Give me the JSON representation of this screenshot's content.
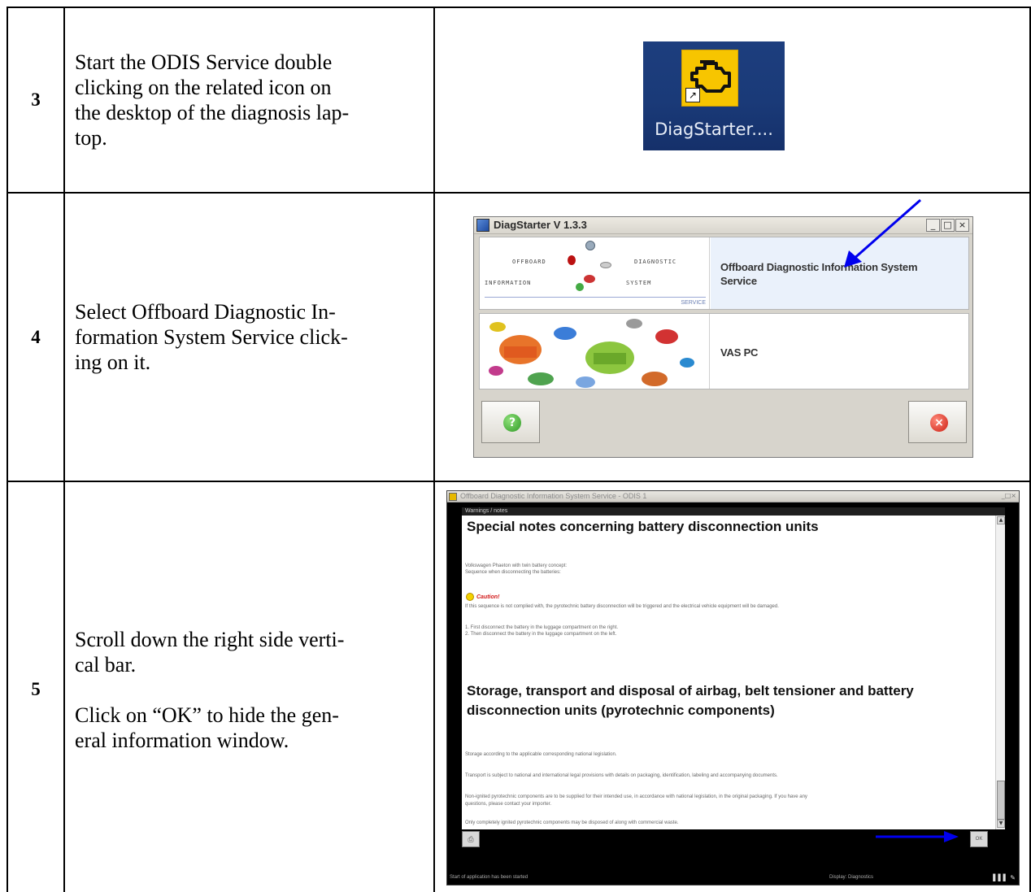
{
  "steps": [
    {
      "number": "3",
      "lines": [
        "Start the ODIS Service double",
        "clicking on the related icon on",
        "the desktop of the diagnosis lap-",
        "top."
      ]
    },
    {
      "number": "4",
      "lines": [
        "Select Offboard Diagnostic In-",
        "formation System Service click-",
        "ing on it."
      ]
    },
    {
      "number": "5",
      "lines": [
        "Scroll down the right side verti-",
        "cal bar."
      ],
      "lines2": [
        "Click on “OK” to hide the gen-",
        "eral information window."
      ]
    }
  ],
  "desktop_icon": {
    "label": "DiagStarter...."
  },
  "diagstarter": {
    "title": "DiagStarter V 1.3.3",
    "window_buttons": [
      "_",
      "□",
      "×"
    ],
    "logo_words": [
      "OFFBOARD",
      "DIAGNOSTIC",
      "INFORMATION",
      "SYSTEM",
      "SERVICE"
    ],
    "option1_lines": [
      "Offboard Diagnostic Information System",
      "Service"
    ],
    "option2": "VAS PC",
    "help_glyph": "?",
    "close_glyph": "×",
    "colors": {
      "highlight": "#eaf1fb",
      "arrow": "#0000ee"
    }
  },
  "odis": {
    "titlebar": "Offboard Diagnostic Information System Service - ODIS 1",
    "titlebar_controls": "_□×",
    "dialog_header": "Warnings / notes",
    "heading1": "Special notes concerning battery disconnection units",
    "note_lines": [
      "Volkswagen Phaeton with twin battery concept:",
      "Sequence when disconnecting the batteries:"
    ],
    "caution": "Caution!",
    "caution_line": "If this sequence is not complied with, the pyrotechnic battery disconnection will be triggered and the electrical vehicle equipment will be damaged.",
    "steps_lines": [
      "1. First disconnect the battery in the luggage compartment on the right.",
      "2. Then disconnect the battery in the luggage compartment on the left."
    ],
    "heading2": "Storage, transport and disposal of airbag, belt tensioner and battery disconnection units (pyrotechnic components)",
    "body_lines": [
      "Storage according to the applicable corresponding national legislation.",
      "Transport is subject to national and international legal provisions with details on packaging, identification, labeling and accompanying documents.",
      "Non-ignited pyrotechnic components are to be supplied for their intended use, in accordance with national legislation, in the original packaging. If you have any",
      "questions, please contact your importer.",
      "Only completely ignited pyrotechnic components may be disposed of along with commercial waste."
    ],
    "print_label": "⎙",
    "ok_label": "OK",
    "status_left": "Start of application has been started",
    "status_middle": "Display: Diagnostics",
    "status_right": "▌▌▌ ✎"
  }
}
